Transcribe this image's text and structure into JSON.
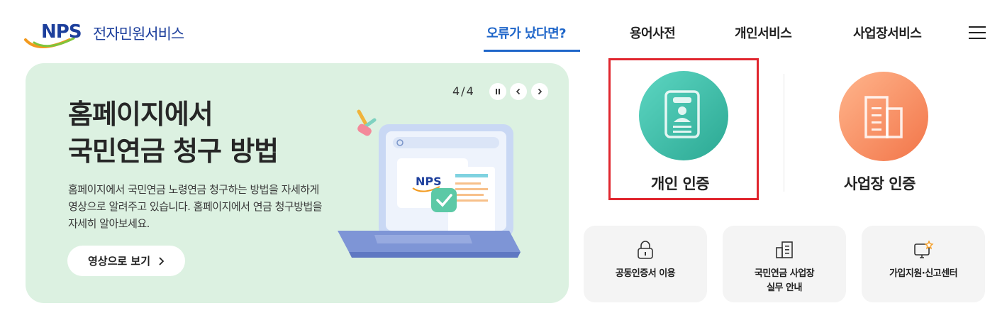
{
  "header": {
    "logo_mark": "NPS",
    "logo_service": "전자민원서비스",
    "nav": [
      {
        "label": "오류가 났다면?",
        "active": true
      },
      {
        "label": "용어사전",
        "active": false
      },
      {
        "label": "개인서비스",
        "active": false
      },
      {
        "label": "사업장서비스",
        "active": false
      }
    ],
    "menu_icon": "hamburger-menu-icon"
  },
  "banner": {
    "title_line1": "홈페이지에서",
    "title_line2": "국민연금 청구 방법",
    "description": "홈페이지에서 국민연금 노령연금 청구하는 방법을 자세하게 영상으로 알려주고 있습니다. 홈페이지에서 연금 청구방법을 자세히 알아보세요.",
    "button_label": "영상으로 보기",
    "counter": "4/4",
    "laptop_logo": "NPS",
    "background": "#dcf1e1"
  },
  "auth": {
    "personal": {
      "label": "개인 인증",
      "icon": "id-card-icon",
      "color": "#2ba893"
    },
    "business": {
      "label": "사업장 인증",
      "icon": "building-icon",
      "color": "#f27549"
    },
    "highlight_color": "#e0262e"
  },
  "quick_links": [
    {
      "label": "공동인증서 이용",
      "icon": "lock-icon"
    },
    {
      "label": "국민연금 사업장\n실무 안내",
      "icon": "document-building-icon"
    },
    {
      "label": "가입지원·신고센터",
      "icon": "monitor-star-icon"
    }
  ]
}
